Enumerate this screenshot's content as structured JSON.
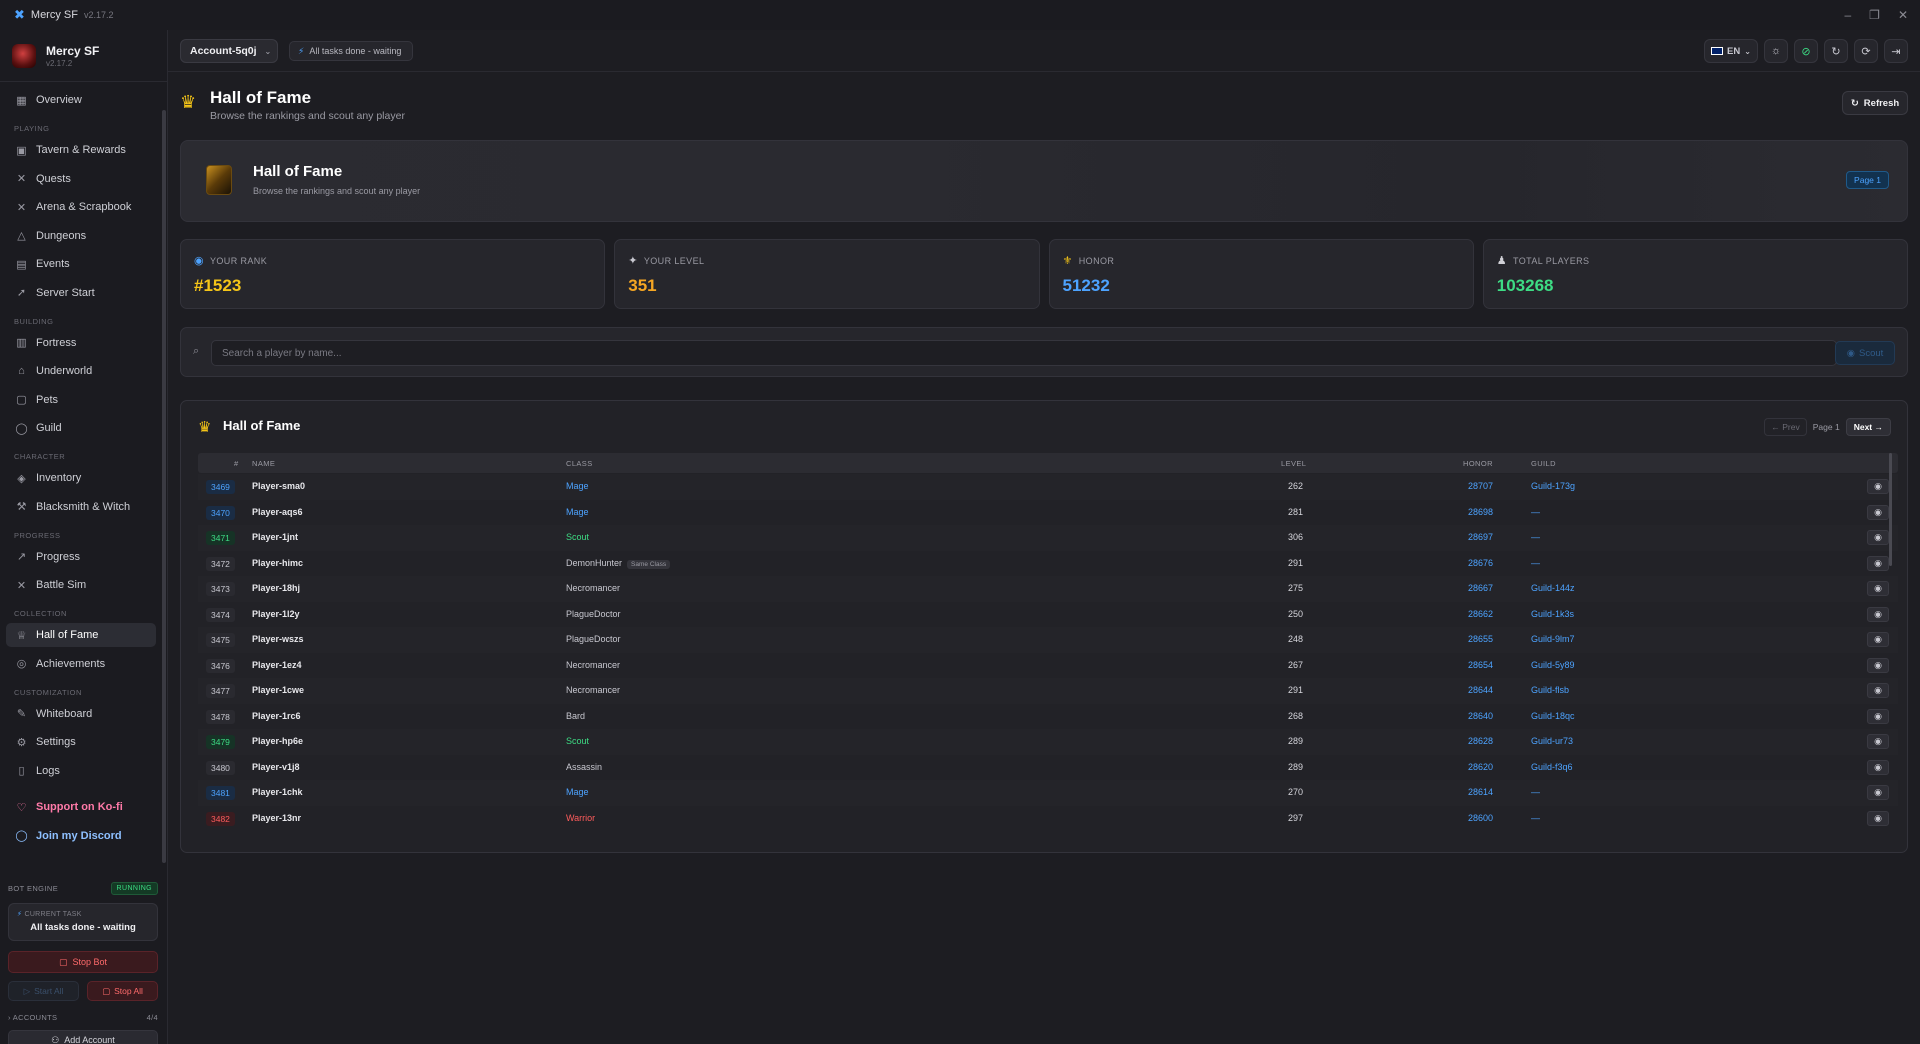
{
  "window": {
    "app_name": "Mercy SF",
    "version": "v2.17.2",
    "min": "–",
    "max": "❐",
    "close": "✕"
  },
  "brand": {
    "name": "Mercy SF",
    "version": "v2.17.2"
  },
  "nav": {
    "overview": "Overview",
    "sec_playing": "PLAYING",
    "tavern": "Tavern & Rewards",
    "quests": "Quests",
    "arena": "Arena & Scrapbook",
    "dungeons": "Dungeons",
    "events": "Events",
    "server_start": "Server Start",
    "sec_building": "BUILDING",
    "fortress": "Fortress",
    "underworld": "Underworld",
    "pets": "Pets",
    "guild": "Guild",
    "sec_character": "CHARACTER",
    "inventory": "Inventory",
    "blacksmith": "Blacksmith & Witch",
    "sec_progress": "PROGRESS",
    "progress": "Progress",
    "battle_sim": "Battle Sim",
    "sec_collection": "COLLECTION",
    "hall_of_fame": "Hall of Fame",
    "achievements": "Achievements",
    "sec_customization": "CUSTOMIZATION",
    "whiteboard": "Whiteboard",
    "settings": "Settings",
    "logs": "Logs",
    "kofi": "Support on Ko-fi",
    "discord": "Join my Discord"
  },
  "engine": {
    "label": "BOT ENGINE",
    "status": "RUNNING",
    "current_task_label": "CURRENT TASK",
    "current_task": "All tasks done - waiting",
    "stop_bot": "Stop Bot",
    "start_all": "Start All",
    "stop_all": "Stop All",
    "accounts_label": "ACCOUNTS",
    "accounts_count": "4/4",
    "add_account": "Add Account"
  },
  "topbar": {
    "account": "Account-5q0j",
    "task_status": "All tasks done - waiting",
    "lang": "EN"
  },
  "page": {
    "title": "Hall of Fame",
    "subtitle": "Browse the rankings and scout any player",
    "refresh": "Refresh"
  },
  "hero": {
    "title": "Hall of Fame",
    "subtitle": "Browse the rankings and scout any player",
    "badge": "Page 1"
  },
  "stats": [
    {
      "label": "YOUR RANK",
      "value": "#1523",
      "color": "#f5c518"
    },
    {
      "label": "YOUR LEVEL",
      "value": "351",
      "color": "#f5a623"
    },
    {
      "label": "HONOR",
      "value": "51232",
      "color": "#4da3ff"
    },
    {
      "label": "TOTAL PLAYERS",
      "value": "103268",
      "color": "#3ddc84"
    }
  ],
  "search": {
    "placeholder": "Search a player by name...",
    "button": "Scout"
  },
  "table": {
    "title": "Hall of Fame",
    "prev": "← Prev",
    "page": "Page 1",
    "next": "Next →",
    "headers": {
      "rank": "#",
      "name": "NAME",
      "class": "CLASS",
      "level": "LEVEL",
      "honor": "HONOR",
      "guild": "GUILD"
    },
    "rows": [
      {
        "rank": "3469",
        "name": "Player-sma0",
        "class": "Mage",
        "level": "262",
        "honor": "28707",
        "guild": "Guild-173g",
        "tag": ""
      },
      {
        "rank": "3470",
        "name": "Player-aqs6",
        "class": "Mage",
        "level": "281",
        "honor": "28698",
        "guild": "—",
        "tag": ""
      },
      {
        "rank": "3471",
        "name": "Player-1jnt",
        "class": "Scout",
        "level": "306",
        "honor": "28697",
        "guild": "—",
        "tag": ""
      },
      {
        "rank": "3472",
        "name": "Player-himc",
        "class": "DemonHunter",
        "level": "291",
        "honor": "28676",
        "guild": "—",
        "tag": "Same Class"
      },
      {
        "rank": "3473",
        "name": "Player-18hj",
        "class": "Necromancer",
        "level": "275",
        "honor": "28667",
        "guild": "Guild-144z",
        "tag": ""
      },
      {
        "rank": "3474",
        "name": "Player-1l2y",
        "class": "PlagueDoctor",
        "level": "250",
        "honor": "28662",
        "guild": "Guild-1k3s",
        "tag": ""
      },
      {
        "rank": "3475",
        "name": "Player-wszs",
        "class": "PlagueDoctor",
        "level": "248",
        "honor": "28655",
        "guild": "Guild-9lm7",
        "tag": ""
      },
      {
        "rank": "3476",
        "name": "Player-1ez4",
        "class": "Necromancer",
        "level": "267",
        "honor": "28654",
        "guild": "Guild-5y89",
        "tag": ""
      },
      {
        "rank": "3477",
        "name": "Player-1cwe",
        "class": "Necromancer",
        "level": "291",
        "honor": "28644",
        "guild": "Guild-flsb",
        "tag": ""
      },
      {
        "rank": "3478",
        "name": "Player-1rc6",
        "class": "Bard",
        "level": "268",
        "honor": "28640",
        "guild": "Guild-18qc",
        "tag": ""
      },
      {
        "rank": "3479",
        "name": "Player-hp6e",
        "class": "Scout",
        "level": "289",
        "honor": "28628",
        "guild": "Guild-ur73",
        "tag": ""
      },
      {
        "rank": "3480",
        "name": "Player-v1j8",
        "class": "Assassin",
        "level": "289",
        "honor": "28620",
        "guild": "Guild-f3q6",
        "tag": ""
      },
      {
        "rank": "3481",
        "name": "Player-1chk",
        "class": "Mage",
        "level": "270",
        "honor": "28614",
        "guild": "—",
        "tag": ""
      },
      {
        "rank": "3482",
        "name": "Player-13nr",
        "class": "Warrior",
        "level": "297",
        "honor": "28600",
        "guild": "—",
        "tag": ""
      }
    ]
  },
  "class_colors": {
    "Mage": "#4da3ff",
    "Scout": "#3ddc84",
    "Warrior": "#ff5c5c",
    "default": "#c8c8d0"
  }
}
